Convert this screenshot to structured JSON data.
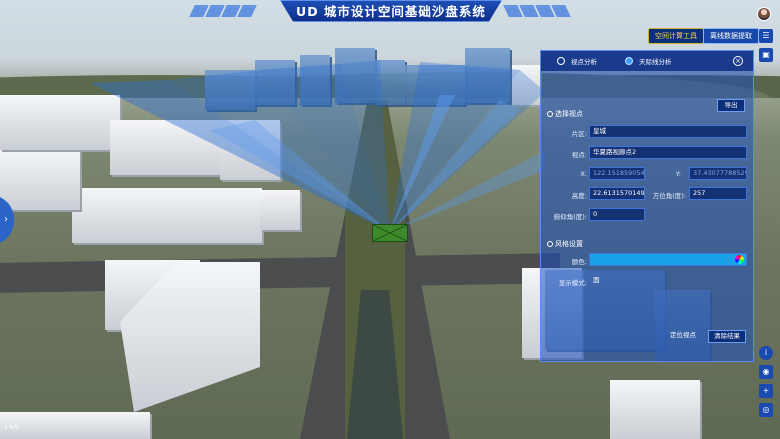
{
  "app": {
    "title": "UD 城市设计空间基础沙盘系统"
  },
  "toolbar": {
    "spatial_tools_label": "空间计算工具",
    "offline_data_label": "离线数据提取"
  },
  "panel": {
    "tabs": [
      {
        "label": "视点分析",
        "selected": false
      },
      {
        "label": "天际线分析",
        "selected": true
      }
    ],
    "export_label": "导出",
    "viewpoint_section": "选择视点",
    "district_label": "片区:",
    "district_value": "皇城",
    "viewpoint_label": "视点:",
    "viewpoint_value": "华夏路视廊点2",
    "x_label": "X:",
    "x_value": "122.15185905402",
    "y_label": "Y:",
    "y_value": "37.43077788529",
    "height_label": "高度:",
    "height_value": "22.61315701491Q",
    "azimuth_label": "方位角(度):",
    "azimuth_value": "257",
    "pitch_label": "俯仰角(度):",
    "pitch_value": "0",
    "style_section": "风格设置",
    "color_label": "颜色:",
    "display_mode_label": "显示模式:",
    "display_mode_value": "面",
    "locate_label": "定位视点",
    "clear_label": "清除结果"
  },
  "colors": {
    "accent": "#1747a8",
    "active_text": "#ffd84d",
    "viewshed": "#2f6fd0",
    "color_swatch": "#1aa2e8"
  },
  "icons": {
    "avatar": "avatar",
    "menu": "list-icon",
    "lock": "lock-icon",
    "info": "info-icon",
    "camera": "camera-icon",
    "plus": "plus-icon",
    "eye": "eye-icon"
  },
  "footer": {
    "scale": "1 km"
  }
}
